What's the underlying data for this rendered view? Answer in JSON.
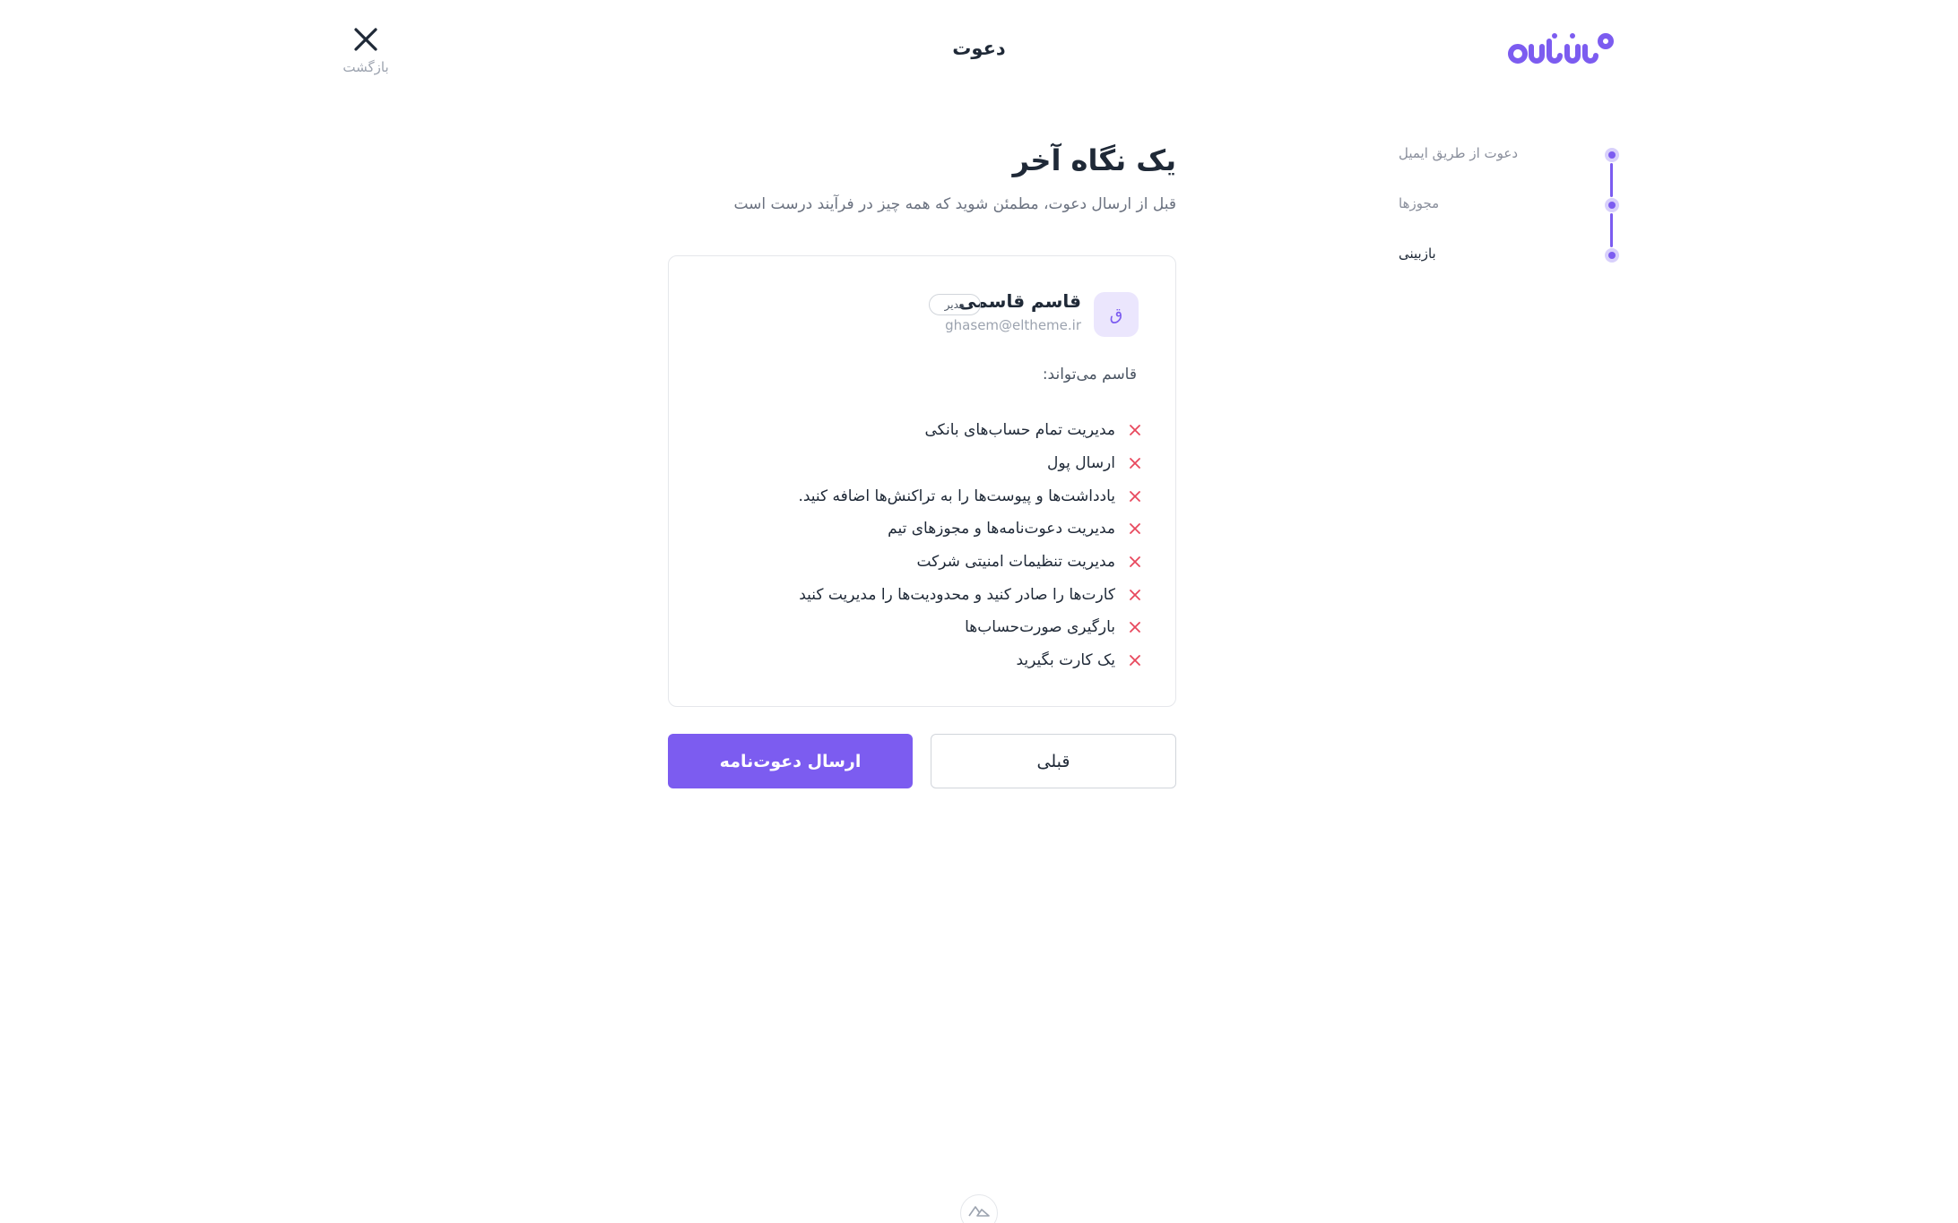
{
  "brand": {
    "logo_text": "دتابرنو",
    "accent_color": "#7c5cf0"
  },
  "header": {
    "title": "دعوت",
    "back_label": "بازگشت",
    "back_icon": "close-icon"
  },
  "stepper": {
    "steps": [
      {
        "label": "دعوت از طریق ایمیل",
        "state": "done"
      },
      {
        "label": "مجوزها",
        "state": "done"
      },
      {
        "label": "بازبینی",
        "state": "current"
      }
    ]
  },
  "review": {
    "title": "یک نگاه آخر",
    "subtitle": "قبل از ارسال دعوت، مطمئن شوید که همه چیز در فرآیند درست است"
  },
  "user": {
    "avatar_initial": "ق",
    "name": "قاسم قاسمی",
    "role": "مدیر",
    "email": "ghasem@eltheme.ir"
  },
  "permissions": {
    "heading": "قاسم می‌تواند:",
    "status_icon": "x-icon",
    "status_color": "#e8485d",
    "items": [
      "مدیریت تمام حساب‌های بانکی",
      "ارسال پول",
      "یادداشت‌ها و پیوست‌ها را به تراکنش‌ها اضافه کنید.",
      "مدیریت دعوت‌نامه‌ها و مجوزهای تیم",
      "مدیریت تنظیمات امنیتی شرکت",
      "کارت‌ها را صادر کنید و محدودیت‌ها را مدیریت کنید",
      "بارگیری صورت‌حساب‌ها",
      "یک کارت بگیرید"
    ]
  },
  "actions": {
    "previous_label": "قبلی",
    "send_label": "ارسال دعوت‌نامه"
  }
}
